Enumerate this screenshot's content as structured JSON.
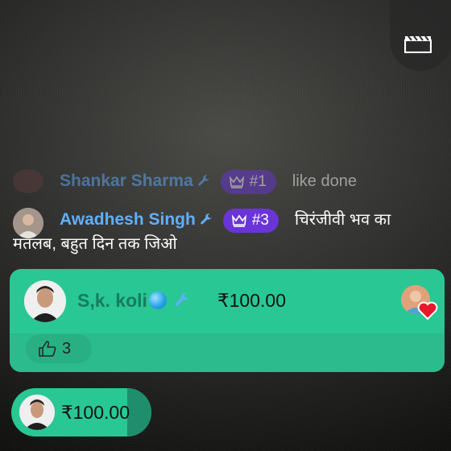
{
  "top_right_button": {
    "icon": "video-clapper-icon"
  },
  "chat": [
    {
      "name": "Shankar Sharma",
      "badge_icon": "wrench-icon",
      "rank": "#1",
      "message": "like done"
    },
    {
      "name": "Awadhesh Singh",
      "badge_icon": "wrench-icon",
      "rank": "#3",
      "message_line1": "चिरंजीवी भव का",
      "message_line2": "मतलब, बहुत दिन तक जिओ"
    }
  ],
  "super_chat": {
    "name": "S,k. koli",
    "verified_icon": "blue-dot-icon",
    "badge_icon": "wrench-icon",
    "amount": "₹100.00",
    "likes": "3",
    "colors": {
      "card": "#29c794",
      "name": "#157c60"
    }
  },
  "bottom_pill": {
    "amount": "₹100.00"
  },
  "colors": {
    "username": "#5fb0ff",
    "rank_badge": "#6a35d6"
  }
}
